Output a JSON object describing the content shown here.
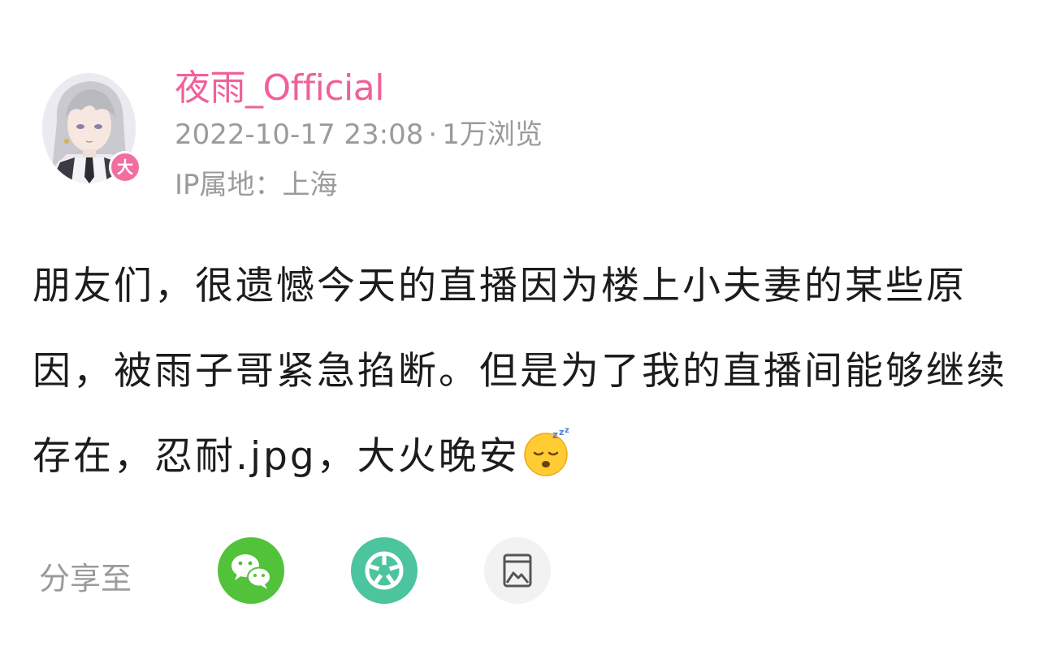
{
  "post": {
    "author": {
      "name": "夜雨_Official",
      "level_badge": "大"
    },
    "date": "2022-10-17 23:08",
    "separator": "·",
    "views": "1万浏览",
    "ip_location": "IP属地：上海",
    "text": "朋友们，很遗憾今天的直播因为楼上小夫妻的某些原因，被雨子哥紧急掐断。但是为了我的直播间能够继续存在，忍耐.jpg，大火晚安",
    "emoji": "sleeping-face-emoji"
  },
  "share": {
    "label": "分享至",
    "targets": [
      {
        "name": "wechat",
        "icon": "wechat-icon",
        "color": "#52c23b"
      },
      {
        "name": "moments",
        "icon": "moments-icon",
        "color": "#4cc49e"
      },
      {
        "name": "save-image",
        "icon": "image-icon",
        "color": "#f2f2f2"
      }
    ]
  },
  "colors": {
    "author_name": "#f0619a",
    "meta_text": "#9b9b9b",
    "body_text": "#1c1c1c",
    "level_badge": "#f06fa0"
  }
}
